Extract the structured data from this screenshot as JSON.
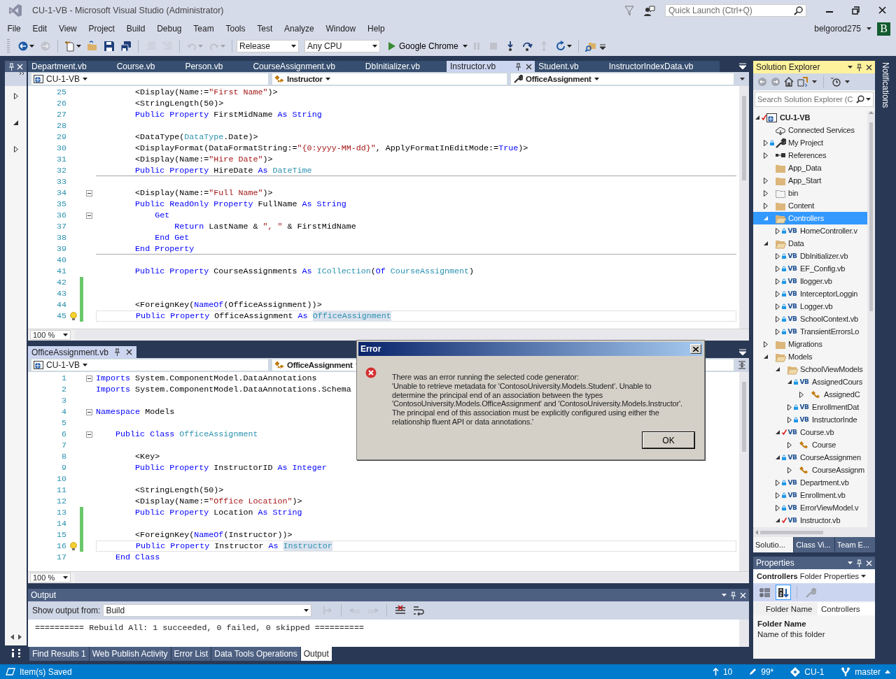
{
  "window": {
    "title": "CU-1-VB - Microsoft Visual Studio  (Administrator)",
    "quick_launch": {
      "placeholder": "Quick Launch (Ctrl+Q)"
    },
    "account": {
      "user": "belgorod275",
      "avatar_letter": "B"
    }
  },
  "menu": [
    "File",
    "Edit",
    "View",
    "Project",
    "Build",
    "Debug",
    "Team",
    "Tools",
    "Test",
    "Analyze",
    "Window",
    "Help"
  ],
  "toolbar": [
    {
      "kind": "button",
      "disabled": false,
      "has_menu": true
    },
    {
      "kind": "button",
      "disabled": true,
      "has_menu": false
    },
    {
      "kind": "separator"
    },
    {
      "kind": "button",
      "disabled": false,
      "has_menu": true
    },
    {
      "kind": "button",
      "disabled": false,
      "has_menu": false
    },
    {
      "kind": "button",
      "disabled": false,
      "has_menu": false
    },
    {
      "kind": "button",
      "disabled": false,
      "has_menu": false
    },
    {
      "kind": "separator"
    },
    {
      "kind": "button",
      "disabled": true,
      "has_menu": false
    },
    {
      "kind": "button",
      "disabled": true,
      "has_menu": false
    },
    {
      "kind": "separator"
    },
    {
      "kind": "button",
      "disabled": true,
      "has_menu": true
    },
    {
      "kind": "button",
      "disabled": true,
      "has_menu": true
    },
    {
      "kind": "separator"
    },
    {
      "kind": "dropdown",
      "value": "Release"
    },
    {
      "kind": "dropdown",
      "value": "Any CPU"
    },
    {
      "kind": "start",
      "label": "Google Chrome"
    },
    {
      "kind": "button",
      "disabled": true,
      "has_menu": false
    },
    {
      "kind": "button",
      "disabled": true,
      "has_menu": false
    },
    {
      "kind": "button",
      "disabled": false,
      "has_menu": false
    },
    {
      "kind": "button",
      "disabled": false,
      "has_menu": false
    },
    {
      "kind": "button",
      "disabled": true,
      "has_menu": false
    },
    {
      "kind": "button",
      "disabled": false,
      "has_menu": true
    },
    {
      "kind": "separator"
    },
    {
      "kind": "button",
      "disabled": false,
      "has_menu": false
    }
  ],
  "editor_tabs": [
    {
      "label": "Department.vb",
      "selected": false
    },
    {
      "label": "Course.vb",
      "selected": false
    },
    {
      "label": "Person.vb",
      "selected": false
    },
    {
      "label": "CourseAssignment.vb",
      "selected": false
    },
    {
      "label": "DbInitializer.vb",
      "selected": false
    },
    {
      "label": "Instructor.vb",
      "selected": true
    },
    {
      "label": "Student.vb",
      "selected": false
    },
    {
      "label": "InstructorIndexData.vb",
      "selected": false
    }
  ],
  "top_editor": {
    "nav": [
      "CU-1-VB",
      "Instructor",
      "OfficeAssignment"
    ],
    "zoom": "100 %",
    "lines": [
      {
        "number": "25",
        "fold": false,
        "changed": false,
        "current": false,
        "separator": false,
        "tokens": [
          {
            "kind": "plain",
            "text": "        <Display(Name:="
          },
          {
            "kind": "string",
            "text": "\"First Name\""
          },
          {
            "kind": "plain",
            "text": ")>"
          }
        ]
      },
      {
        "number": "26",
        "fold": false,
        "changed": false,
        "current": false,
        "separator": false,
        "tokens": [
          {
            "kind": "plain",
            "text": "        <StringLength(50)>"
          }
        ]
      },
      {
        "number": "27",
        "fold": false,
        "changed": false,
        "current": false,
        "separator": false,
        "tokens": [
          {
            "kind": "keyword",
            "text": "        Public Property"
          },
          {
            "kind": "plain",
            "text": " FirstMidName "
          },
          {
            "kind": "keyword",
            "text": "As String"
          }
        ]
      },
      {
        "number": "28",
        "fold": false,
        "changed": false,
        "current": false,
        "separator": false
      },
      {
        "number": "29",
        "fold": false,
        "changed": false,
        "current": false,
        "separator": false,
        "tokens": [
          {
            "kind": "plain",
            "text": "        <DataType("
          },
          {
            "kind": "type",
            "text": "DataType"
          },
          {
            "kind": "plain",
            "text": ".Date)>"
          }
        ]
      },
      {
        "number": "30",
        "fold": false,
        "changed": false,
        "current": false,
        "separator": false,
        "tokens": [
          {
            "kind": "plain",
            "text": "        <DisplayFormat(DataFormatString:="
          },
          {
            "kind": "string",
            "text": "\"{0:yyyy-MM-dd}\""
          },
          {
            "kind": "plain",
            "text": ", ApplyFormatInEditMode:="
          },
          {
            "kind": "keyword",
            "text": "True"
          },
          {
            "kind": "plain",
            "text": ")>"
          }
        ]
      },
      {
        "number": "31",
        "fold": false,
        "changed": false,
        "current": false,
        "separator": false,
        "tokens": [
          {
            "kind": "plain",
            "text": "        <Display(Name:="
          },
          {
            "kind": "string",
            "text": "\"Hire Date\""
          },
          {
            "kind": "plain",
            "text": ")>"
          }
        ]
      },
      {
        "number": "32",
        "fold": false,
        "changed": false,
        "current": false,
        "separator": true,
        "tokens": [
          {
            "kind": "keyword",
            "text": "        Public Property"
          },
          {
            "kind": "plain",
            "text": " HireDate "
          },
          {
            "kind": "keyword",
            "text": "As "
          },
          {
            "kind": "type",
            "text": "DateTime"
          }
        ]
      },
      {
        "number": "33",
        "fold": false,
        "changed": false,
        "current": false,
        "separator": false
      },
      {
        "number": "34",
        "fold": true,
        "changed": false,
        "current": false,
        "separator": false,
        "tokens": [
          {
            "kind": "plain",
            "text": "        <Display(Name:="
          },
          {
            "kind": "string",
            "text": "\"Full Name\""
          },
          {
            "kind": "plain",
            "text": ")>"
          }
        ]
      },
      {
        "number": "35",
        "fold": false,
        "changed": false,
        "current": false,
        "separator": false,
        "tokens": [
          {
            "kind": "keyword",
            "text": "        Public ReadOnly Property"
          },
          {
            "kind": "plain",
            "text": " FullName "
          },
          {
            "kind": "keyword",
            "text": "As String"
          }
        ]
      },
      {
        "number": "36",
        "fold": true,
        "changed": false,
        "current": false,
        "separator": false,
        "tokens": [
          {
            "kind": "keyword",
            "text": "            Get"
          }
        ]
      },
      {
        "number": "37",
        "fold": false,
        "changed": false,
        "current": false,
        "separator": false,
        "tokens": [
          {
            "kind": "keyword",
            "text": "                Return"
          },
          {
            "kind": "plain",
            "text": " LastName & "
          },
          {
            "kind": "string",
            "text": "\", \""
          },
          {
            "kind": "plain",
            "text": " & FirstMidName"
          }
        ]
      },
      {
        "number": "38",
        "fold": false,
        "changed": false,
        "current": false,
        "separator": false,
        "tokens": [
          {
            "kind": "keyword",
            "text": "            End Get"
          }
        ]
      },
      {
        "number": "39",
        "fold": false,
        "changed": false,
        "current": false,
        "separator": true,
        "tokens": [
          {
            "kind": "keyword",
            "text": "        End Property"
          }
        ]
      },
      {
        "number": "40",
        "fold": false,
        "changed": false,
        "current": false,
        "separator": false
      },
      {
        "number": "41",
        "fold": false,
        "changed": false,
        "current": false,
        "separator": false,
        "tokens": [
          {
            "kind": "keyword",
            "text": "        Public Property"
          },
          {
            "kind": "plain",
            "text": " CourseAssignments "
          },
          {
            "kind": "keyword",
            "text": "As "
          },
          {
            "kind": "type",
            "text": "ICollection"
          },
          {
            "kind": "plain",
            "text": "("
          },
          {
            "kind": "keyword",
            "text": "Of "
          },
          {
            "kind": "type",
            "text": "CourseAssignment"
          },
          {
            "kind": "plain",
            "text": ")"
          }
        ]
      },
      {
        "number": "42",
        "fold": false,
        "changed": true,
        "current": false,
        "separator": false
      },
      {
        "number": "43",
        "fold": false,
        "changed": true,
        "current": false,
        "separator": false
      },
      {
        "number": "44",
        "fold": false,
        "changed": true,
        "current": false,
        "separator": false,
        "tokens": [
          {
            "kind": "plain",
            "text": "        <ForeignKey("
          },
          {
            "kind": "keyword",
            "text": "NameOf"
          },
          {
            "kind": "plain",
            "text": "(OfficeAssignment))>"
          }
        ]
      },
      {
        "number": "45",
        "fold": false,
        "changed": true,
        "current": true,
        "separator": false,
        "tokens": [
          {
            "kind": "keyword",
            "text": "        Public Property"
          },
          {
            "kind": "plain",
            "text": " OfficeAssignment "
          },
          {
            "kind": "keyword",
            "text": "As "
          },
          {
            "kind": "reference",
            "text": "OfficeAssignment"
          }
        ]
      }
    ]
  },
  "bottom_editor": {
    "tab": "OfficeAssignment.vb",
    "nav": [
      "CU-1-VB",
      "OfficeAssignment"
    ],
    "zoom": "100 %",
    "lines": [
      {
        "number": "1",
        "fold": true,
        "changed": false,
        "current": false,
        "separator": false,
        "tokens": [
          {
            "kind": "keyword",
            "text": "Imports"
          },
          {
            "kind": "plain",
            "text": " System.ComponentModel.DataAnnotations"
          }
        ]
      },
      {
        "number": "2",
        "fold": false,
        "changed": false,
        "current": false,
        "separator": false,
        "tokens": [
          {
            "kind": "keyword",
            "text": "Imports"
          },
          {
            "kind": "plain",
            "text": " System.ComponentModel.DataAnnotations.Schema"
          }
        ]
      },
      {
        "number": "3",
        "fold": false,
        "changed": false,
        "current": false,
        "separator": false
      },
      {
        "number": "4",
        "fold": true,
        "changed": false,
        "current": false,
        "separator": false,
        "tokens": [
          {
            "kind": "keyword",
            "text": "Namespace"
          },
          {
            "kind": "plain",
            "text": " Models"
          }
        ]
      },
      {
        "number": "5",
        "fold": false,
        "changed": false,
        "current": false,
        "separator": false
      },
      {
        "number": "6",
        "fold": true,
        "changed": false,
        "current": false,
        "separator": false,
        "tokens": [
          {
            "kind": "keyword",
            "text": "    Public Class "
          },
          {
            "kind": "type",
            "text": "OfficeAssignment"
          }
        ]
      },
      {
        "number": "7",
        "fold": false,
        "changed": false,
        "current": false,
        "separator": false
      },
      {
        "number": "8",
        "fold": false,
        "changed": false,
        "current": false,
        "separator": false,
        "tokens": [
          {
            "kind": "plain",
            "text": "        <Key>"
          }
        ]
      },
      {
        "number": "9",
        "fold": false,
        "changed": false,
        "current": false,
        "separator": false,
        "tokens": [
          {
            "kind": "keyword",
            "text": "        Public Property"
          },
          {
            "kind": "plain",
            "text": " InstructorID "
          },
          {
            "kind": "keyword",
            "text": "As Integer"
          }
        ]
      },
      {
        "number": "10",
        "fold": false,
        "changed": false,
        "current": false,
        "separator": false
      },
      {
        "number": "11",
        "fold": false,
        "changed": false,
        "current": false,
        "separator": false,
        "tokens": [
          {
            "kind": "plain",
            "text": "        <StringLength(50)>"
          }
        ]
      },
      {
        "number": "12",
        "fold": false,
        "changed": false,
        "current": false,
        "separator": false,
        "tokens": [
          {
            "kind": "plain",
            "text": "        <Display(Name:="
          },
          {
            "kind": "string",
            "text": "\"Office Location\""
          },
          {
            "kind": "plain",
            "text": ")>"
          }
        ]
      },
      {
        "number": "13",
        "fold": false,
        "changed": true,
        "current": false,
        "separator": false,
        "tokens": [
          {
            "kind": "keyword",
            "text": "        Public Property"
          },
          {
            "kind": "plain",
            "text": " Location "
          },
          {
            "kind": "keyword",
            "text": "As String"
          }
        ]
      },
      {
        "number": "14",
        "fold": false,
        "changed": true,
        "current": false,
        "separator": false
      },
      {
        "number": "15",
        "fold": false,
        "changed": true,
        "current": false,
        "separator": false,
        "tokens": [
          {
            "kind": "plain",
            "text": "        <ForeignKey("
          },
          {
            "kind": "keyword",
            "text": "NameOf"
          },
          {
            "kind": "plain",
            "text": "(Instructor))>"
          }
        ]
      },
      {
        "number": "16",
        "fold": false,
        "changed": true,
        "current": true,
        "separator": false,
        "tokens": [
          {
            "kind": "keyword",
            "text": "        Public Property"
          },
          {
            "kind": "plain",
            "text": " Instructor "
          },
          {
            "kind": "keyword",
            "text": "As "
          },
          {
            "kind": "reference",
            "text": "Instructor"
          }
        ]
      },
      {
        "number": "17",
        "fold": false,
        "changed": false,
        "current": false,
        "separator": false,
        "tokens": [
          {
            "kind": "keyword",
            "text": "    End Class"
          }
        ]
      }
    ]
  },
  "dialog": {
    "title": "Error",
    "message": "There was an error running the selected code generator:\n'Unable to retrieve metadata for 'ContosoUniversity.Models.Student'. Unable to\ndetermine the principal end of an association between the types\n'ContosoUniversity.Models.OfficeAssignment' and 'ContosoUniversity.Models.Instructor'.\nThe principal end of this association must be explicitly configured using either the\nrelationship fluent API or data annotations.'",
    "button": "OK"
  },
  "solution_explorer": {
    "title": "Solution Explorer",
    "search": {
      "placeholder": "Search Solution Explorer (C"
    },
    "tree": [
      {
        "label": "CU-1-VB",
        "kind": "solution",
        "has_toggle": true,
        "expanded": true,
        "locked": false,
        "checked_out": true,
        "selected": false,
        "children": [
          {
            "label": "Connected Services",
            "kind": "cloud",
            "has_toggle": false,
            "locked": false,
            "checked_out": false,
            "selected": false
          },
          {
            "label": "My Project",
            "kind": "wrench",
            "has_toggle": true,
            "expanded": false,
            "locked": true,
            "checked_out": false,
            "selected": false
          },
          {
            "label": "References",
            "kind": "references",
            "has_toggle": true,
            "expanded": false,
            "locked": false,
            "checked_out": false,
            "selected": false
          },
          {
            "label": "App_Data",
            "kind": "folder",
            "has_toggle": false,
            "locked": false,
            "checked_out": false,
            "selected": false
          },
          {
            "label": "App_Start",
            "kind": "folder",
            "has_toggle": true,
            "expanded": false,
            "locked": false,
            "checked_out": false,
            "selected": false
          },
          {
            "label": "bin",
            "kind": "hidden-folder",
            "has_toggle": true,
            "expanded": false,
            "locked": false,
            "checked_out": false,
            "selected": false
          },
          {
            "label": "Content",
            "kind": "folder",
            "has_toggle": true,
            "expanded": false,
            "locked": false,
            "checked_out": false,
            "selected": false
          },
          {
            "label": "Controllers",
            "kind": "open-folder",
            "has_toggle": true,
            "expanded": true,
            "locked": false,
            "checked_out": false,
            "selected": true,
            "children": [
              {
                "label": "HomeController.v",
                "kind": "vb-file",
                "icon_text": "VB",
                "has_toggle": true,
                "expanded": false,
                "locked": true,
                "checked_out": false,
                "selected": false
              }
            ]
          },
          {
            "label": "Data",
            "kind": "open-folder",
            "has_toggle": true,
            "expanded": true,
            "locked": false,
            "checked_out": false,
            "selected": false,
            "children": [
              {
                "label": "DbInitializer.vb",
                "kind": "vb-file",
                "icon_text": "VB",
                "has_toggle": true,
                "expanded": false,
                "locked": true,
                "checked_out": false,
                "selected": false
              },
              {
                "label": "EF_Config.vb",
                "kind": "vb-file",
                "icon_text": "VB",
                "has_toggle": true,
                "expanded": false,
                "locked": true,
                "checked_out": false,
                "selected": false
              },
              {
                "label": "Ilogger.vb",
                "kind": "vb-file",
                "icon_text": "VB",
                "has_toggle": true,
                "expanded": false,
                "locked": true,
                "checked_out": false,
                "selected": false
              },
              {
                "label": "InterceptorLoggin",
                "kind": "vb-file",
                "icon_text": "VB",
                "has_toggle": true,
                "expanded": false,
                "locked": true,
                "checked_out": false,
                "selected": false
              },
              {
                "label": "Logger.vb",
                "kind": "vb-file",
                "icon_text": "VB",
                "has_toggle": true,
                "expanded": false,
                "locked": true,
                "checked_out": false,
                "selected": false
              },
              {
                "label": "SchoolContext.vb",
                "kind": "vb-file",
                "icon_text": "VB",
                "has_toggle": true,
                "expanded": false,
                "locked": true,
                "checked_out": false,
                "selected": false
              },
              {
                "label": "TransientErrorsLo",
                "kind": "vb-file",
                "icon_text": "VB",
                "has_toggle": true,
                "expanded": false,
                "locked": true,
                "checked_out": false,
                "selected": false
              }
            ]
          },
          {
            "label": "Migrations",
            "kind": "folder",
            "has_toggle": true,
            "expanded": false,
            "locked": false,
            "checked_out": false,
            "selected": false
          },
          {
            "label": "Models",
            "kind": "open-folder",
            "has_toggle": true,
            "expanded": true,
            "locked": false,
            "checked_out": false,
            "selected": false,
            "children": [
              {
                "label": "SchoolViewModels",
                "kind": "open-folder",
                "has_toggle": true,
                "expanded": true,
                "locked": false,
                "checked_out": false,
                "selected": false,
                "children": [
                  {
                    "label": "AssignedCours",
                    "kind": "vb-file",
                    "icon_text": "VB",
                    "has_toggle": true,
                    "expanded": true,
                    "locked": true,
                    "checked_out": false,
                    "selected": false,
                    "children": [
                      {
                        "label": "AssignedC",
                        "kind": "class",
                        "has_toggle": true,
                        "expanded": false,
                        "locked": false,
                        "checked_out": false,
                        "selected": false
                      }
                    ]
                  },
                  {
                    "label": "EnrollmentDat",
                    "kind": "vb-file",
                    "icon_text": "VB",
                    "has_toggle": true,
                    "expanded": false,
                    "locked": true,
                    "checked_out": false,
                    "selected": false
                  },
                  {
                    "label": "InstructorInde",
                    "kind": "vb-file",
                    "icon_text": "VB",
                    "has_toggle": true,
                    "expanded": false,
                    "locked": true,
                    "checked_out": false,
                    "selected": false
                  }
                ]
              },
              {
                "label": "Course.vb",
                "kind": "vb-file",
                "icon_text": "VB",
                "has_toggle": true,
                "expanded": true,
                "locked": false,
                "checked_out": true,
                "selected": false,
                "children": [
                  {
                    "label": "Course",
                    "kind": "class",
                    "has_toggle": true,
                    "expanded": false,
                    "locked": false,
                    "checked_out": false,
                    "selected": false
                  }
                ]
              },
              {
                "label": "CourseAssignmen",
                "kind": "vb-file",
                "icon_text": "VB",
                "has_toggle": true,
                "expanded": true,
                "locked": true,
                "checked_out": false,
                "selected": false,
                "children": [
                  {
                    "label": "CourseAssignm",
                    "kind": "class",
                    "has_toggle": true,
                    "expanded": false,
                    "locked": false,
                    "checked_out": false,
                    "selected": false
                  }
                ]
              },
              {
                "label": "Department.vb",
                "kind": "vb-file",
                "icon_text": "VB",
                "has_toggle": true,
                "expanded": false,
                "locked": true,
                "checked_out": false,
                "selected": false
              },
              {
                "label": "Enrollment.vb",
                "kind": "vb-file",
                "icon_text": "VB",
                "has_toggle": true,
                "expanded": false,
                "locked": true,
                "checked_out": false,
                "selected": false
              },
              {
                "label": "ErrorViewModel.v",
                "kind": "vb-file",
                "icon_text": "VB",
                "has_toggle": true,
                "expanded": false,
                "locked": true,
                "checked_out": false,
                "selected": false
              },
              {
                "label": "Instructor.vb",
                "kind": "vb-file",
                "icon_text": "VB",
                "has_toggle": true,
                "expanded": true,
                "locked": false,
                "checked_out": true,
                "selected": false
              }
            ]
          }
        ]
      }
    ],
    "tabs": [
      {
        "label": "Solutio...",
        "selected": true
      },
      {
        "label": "Class Vi...",
        "selected": false
      },
      {
        "label": "Team E...",
        "selected": false
      }
    ]
  },
  "properties": {
    "title": "Properties",
    "object": "Controllers",
    "object_type": "Folder Properties",
    "toolbar": [
      {
        "kind": "categorized",
        "selected": false
      },
      {
        "kind": "alphabetical",
        "selected": true
      },
      {
        "kind": "property-pages",
        "disabled": true
      }
    ],
    "rows": [
      {
        "name": "Folder Name",
        "value": "Controllers"
      }
    ],
    "description": {
      "title": "Folder Name",
      "text": "Name of this folder"
    }
  },
  "output": {
    "title": "Output",
    "source_label": "Show output from:",
    "source": "Build",
    "tools": [
      {
        "disabled": true
      },
      {
        "disabled": true
      },
      {
        "disabled": true
      },
      {
        "disabled": false
      },
      {
        "disabled": false
      }
    ],
    "lines": [
      "========== Rebuild All: 1 succeeded, 0 failed, 0 skipped =========="
    ]
  },
  "bottom_tabs": [
    {
      "label": "Find Results 1",
      "selected": false
    },
    {
      "label": "Web Publish Activity",
      "selected": false
    },
    {
      "label": "Error List",
      "selected": false
    },
    {
      "label": "Data Tools Operations",
      "selected": false
    },
    {
      "label": "Output",
      "selected": true
    }
  ],
  "notifications": {
    "label": "Notifications"
  },
  "status_bar": {
    "message": "Item(s) Saved",
    "pending": "10",
    "changes": "99*",
    "repo": "CU-1",
    "branch": "master"
  }
}
